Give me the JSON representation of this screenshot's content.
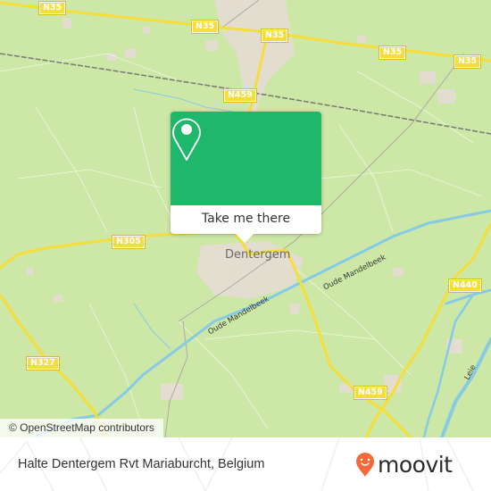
{
  "map": {
    "place_label": "Dentergem",
    "road_shields": [
      {
        "id": "n35-a",
        "label": "N35"
      },
      {
        "id": "n35-b",
        "label": "N35"
      },
      {
        "id": "n35-c",
        "label": "N35"
      },
      {
        "id": "n35-d",
        "label": "N35"
      },
      {
        "id": "n35-e",
        "label": "N35"
      },
      {
        "id": "n459-north",
        "label": "N459"
      },
      {
        "id": "n305",
        "label": "N305"
      },
      {
        "id": "n440",
        "label": "N440"
      },
      {
        "id": "n327",
        "label": "N327"
      },
      {
        "id": "n459-south",
        "label": "N459"
      }
    ],
    "water_labels": [
      {
        "id": "oude-mandelbeek-east",
        "label": "Oude Mandelbeek"
      },
      {
        "id": "oude-mandelbeek-west",
        "label": "Oude Mandelbeek"
      },
      {
        "id": "leie",
        "label": "Leie"
      }
    ],
    "attribution": "© OpenStreetMap contributors",
    "colors": {
      "land": "#cde7a6",
      "road": "#f5dd3a",
      "water": "#86cbe3",
      "urban": "#e6ddd5"
    }
  },
  "popup": {
    "icon": "map-pin-icon",
    "button_label": "Take me there",
    "accent": "#1fb86a"
  },
  "footer": {
    "title": "Halte Dentergem Rvt Mariaburcht, Belgium",
    "logo_text": "moovit",
    "logo_icon": "moovit-pin-smile-icon",
    "logo_color": "#f26a3d"
  }
}
